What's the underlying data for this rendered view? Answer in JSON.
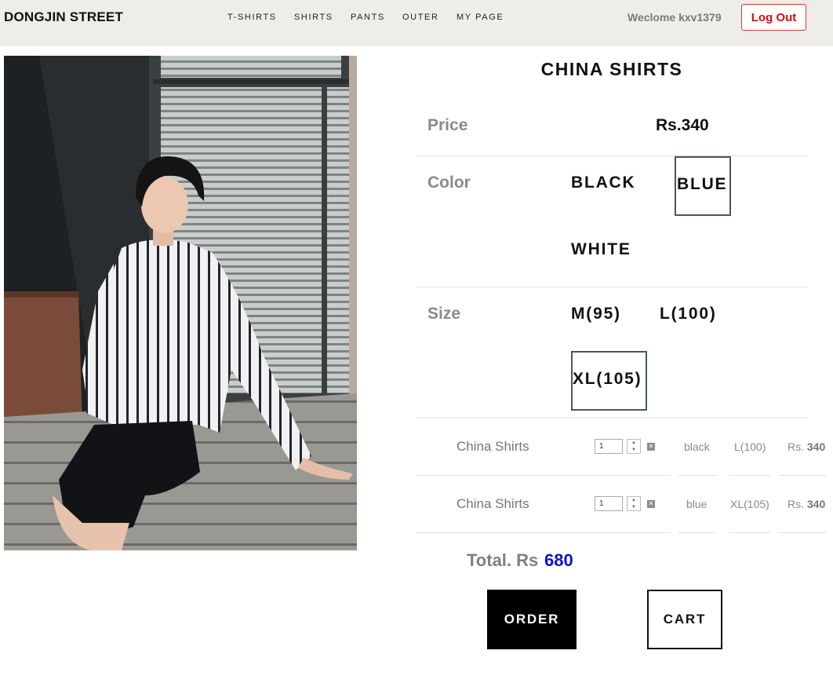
{
  "header": {
    "brand": "DONGJIN STREET",
    "nav": [
      "T-SHIRTS",
      "SHIRTS",
      "PANTS",
      "OUTER",
      "MY PAGE"
    ],
    "welcome": "Weclome kxv1379",
    "logout_label": "Log Out"
  },
  "product": {
    "title": "CHINA SHIRTS",
    "price_label": "Price",
    "price_value": "Rs.340",
    "color_label": "Color",
    "colors": [
      "BLACK",
      "BLUE",
      "WHITE"
    ],
    "selected_color": "BLUE",
    "size_label": "Size",
    "sizes": [
      "M(95)",
      "L(100)",
      "XL(105)"
    ],
    "selected_size": "XL(105)"
  },
  "cart": {
    "items": [
      {
        "name": "China Shirts",
        "qty": "1",
        "color": "black",
        "size": "L(100)",
        "price_prefix": "Rs.",
        "price": "340"
      },
      {
        "name": "China Shirts",
        "qty": "1",
        "color": "blue",
        "size": "XL(105)",
        "price_prefix": "Rs.",
        "price": "340"
      }
    ],
    "total_label": "Total. Rs",
    "total_value": "680"
  },
  "actions": {
    "order_label": "ORDER",
    "cart_label": "CART"
  },
  "colors": {
    "header_bg": "#eeede9",
    "logout_red": "#d01010",
    "total_blue": "#1010cc"
  }
}
